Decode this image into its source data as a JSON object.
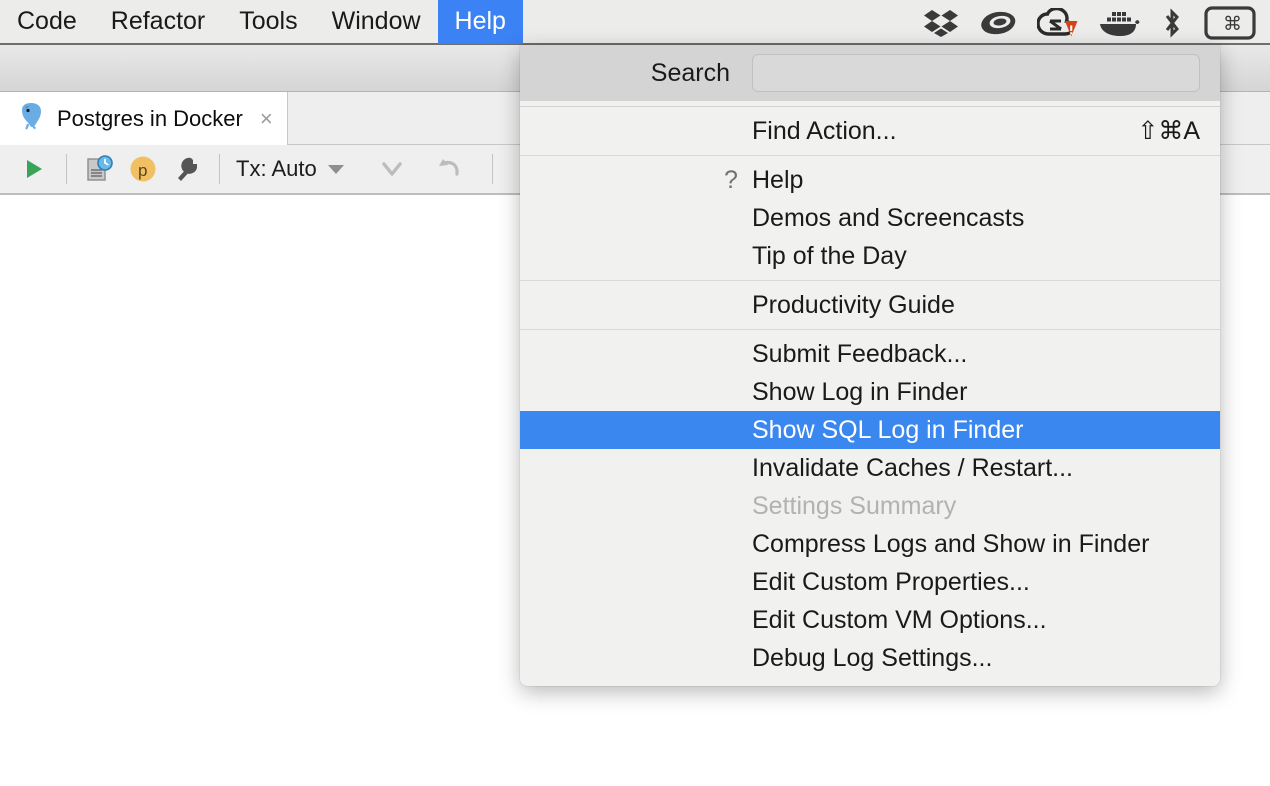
{
  "menubar": {
    "items": [
      {
        "label": "Code",
        "active": false
      },
      {
        "label": "Refactor",
        "active": false
      },
      {
        "label": "Tools",
        "active": false
      },
      {
        "label": "Window",
        "active": false
      },
      {
        "label": "Help",
        "active": true
      }
    ],
    "tray": [
      {
        "icon": "dropbox-icon"
      },
      {
        "icon": "mouse-icon"
      },
      {
        "icon": "adobe-creative-cloud-warning-icon"
      },
      {
        "icon": "docker-whale-icon"
      },
      {
        "icon": "bluetooth-icon"
      },
      {
        "icon": "command-key-icon"
      }
    ],
    "active_accent": "#3b82f5"
  },
  "window": {
    "tab": {
      "icon": "postgres-elephant-icon",
      "label": "Postgres in Docker",
      "close": "×"
    },
    "toolbar": {
      "run_icon": "run-play-icon",
      "history_icon": "query-history-icon",
      "profile_icon": "profile-p-icon",
      "settings_icon": "wrench-icon",
      "tx_label": "Tx: Auto",
      "commit_icon": "commit-chevron-down-icon",
      "rollback_icon": "rollback-undo-icon"
    }
  },
  "help_menu": {
    "search": {
      "label": "Search",
      "value": "",
      "placeholder": ""
    },
    "groups": [
      {
        "items": [
          {
            "label": "Find Action...",
            "shortcut": "⇧⌘A",
            "icon": null,
            "disabled": false,
            "selected": false
          }
        ]
      },
      {
        "items": [
          {
            "label": "Help",
            "shortcut": "",
            "icon": "?",
            "disabled": false,
            "selected": false
          },
          {
            "label": "Demos and Screencasts",
            "shortcut": "",
            "icon": null,
            "disabled": false,
            "selected": false
          },
          {
            "label": "Tip of the Day",
            "shortcut": "",
            "icon": null,
            "disabled": false,
            "selected": false
          }
        ]
      },
      {
        "items": [
          {
            "label": "Productivity Guide",
            "shortcut": "",
            "icon": null,
            "disabled": false,
            "selected": false
          }
        ]
      },
      {
        "items": [
          {
            "label": "Submit Feedback...",
            "shortcut": "",
            "icon": null,
            "disabled": false,
            "selected": false
          },
          {
            "label": "Show Log in Finder",
            "shortcut": "",
            "icon": null,
            "disabled": false,
            "selected": false
          },
          {
            "label": "Show SQL Log in Finder",
            "shortcut": "",
            "icon": null,
            "disabled": false,
            "selected": true
          },
          {
            "label": "Invalidate Caches / Restart...",
            "shortcut": "",
            "icon": null,
            "disabled": false,
            "selected": false
          },
          {
            "label": "Settings Summary",
            "shortcut": "",
            "icon": null,
            "disabled": true,
            "selected": false
          },
          {
            "label": "Compress Logs and Show in Finder",
            "shortcut": "",
            "icon": null,
            "disabled": false,
            "selected": false
          },
          {
            "label": "Edit Custom Properties...",
            "shortcut": "",
            "icon": null,
            "disabled": false,
            "selected": false
          },
          {
            "label": "Edit Custom VM Options...",
            "shortcut": "",
            "icon": null,
            "disabled": false,
            "selected": false
          },
          {
            "label": "Debug Log Settings...",
            "shortcut": "",
            "icon": null,
            "disabled": false,
            "selected": false
          }
        ]
      }
    ],
    "selection_color": "#3b87f0",
    "background_color": "#f1f1ef",
    "search_row_color": "#d4d4d4"
  }
}
